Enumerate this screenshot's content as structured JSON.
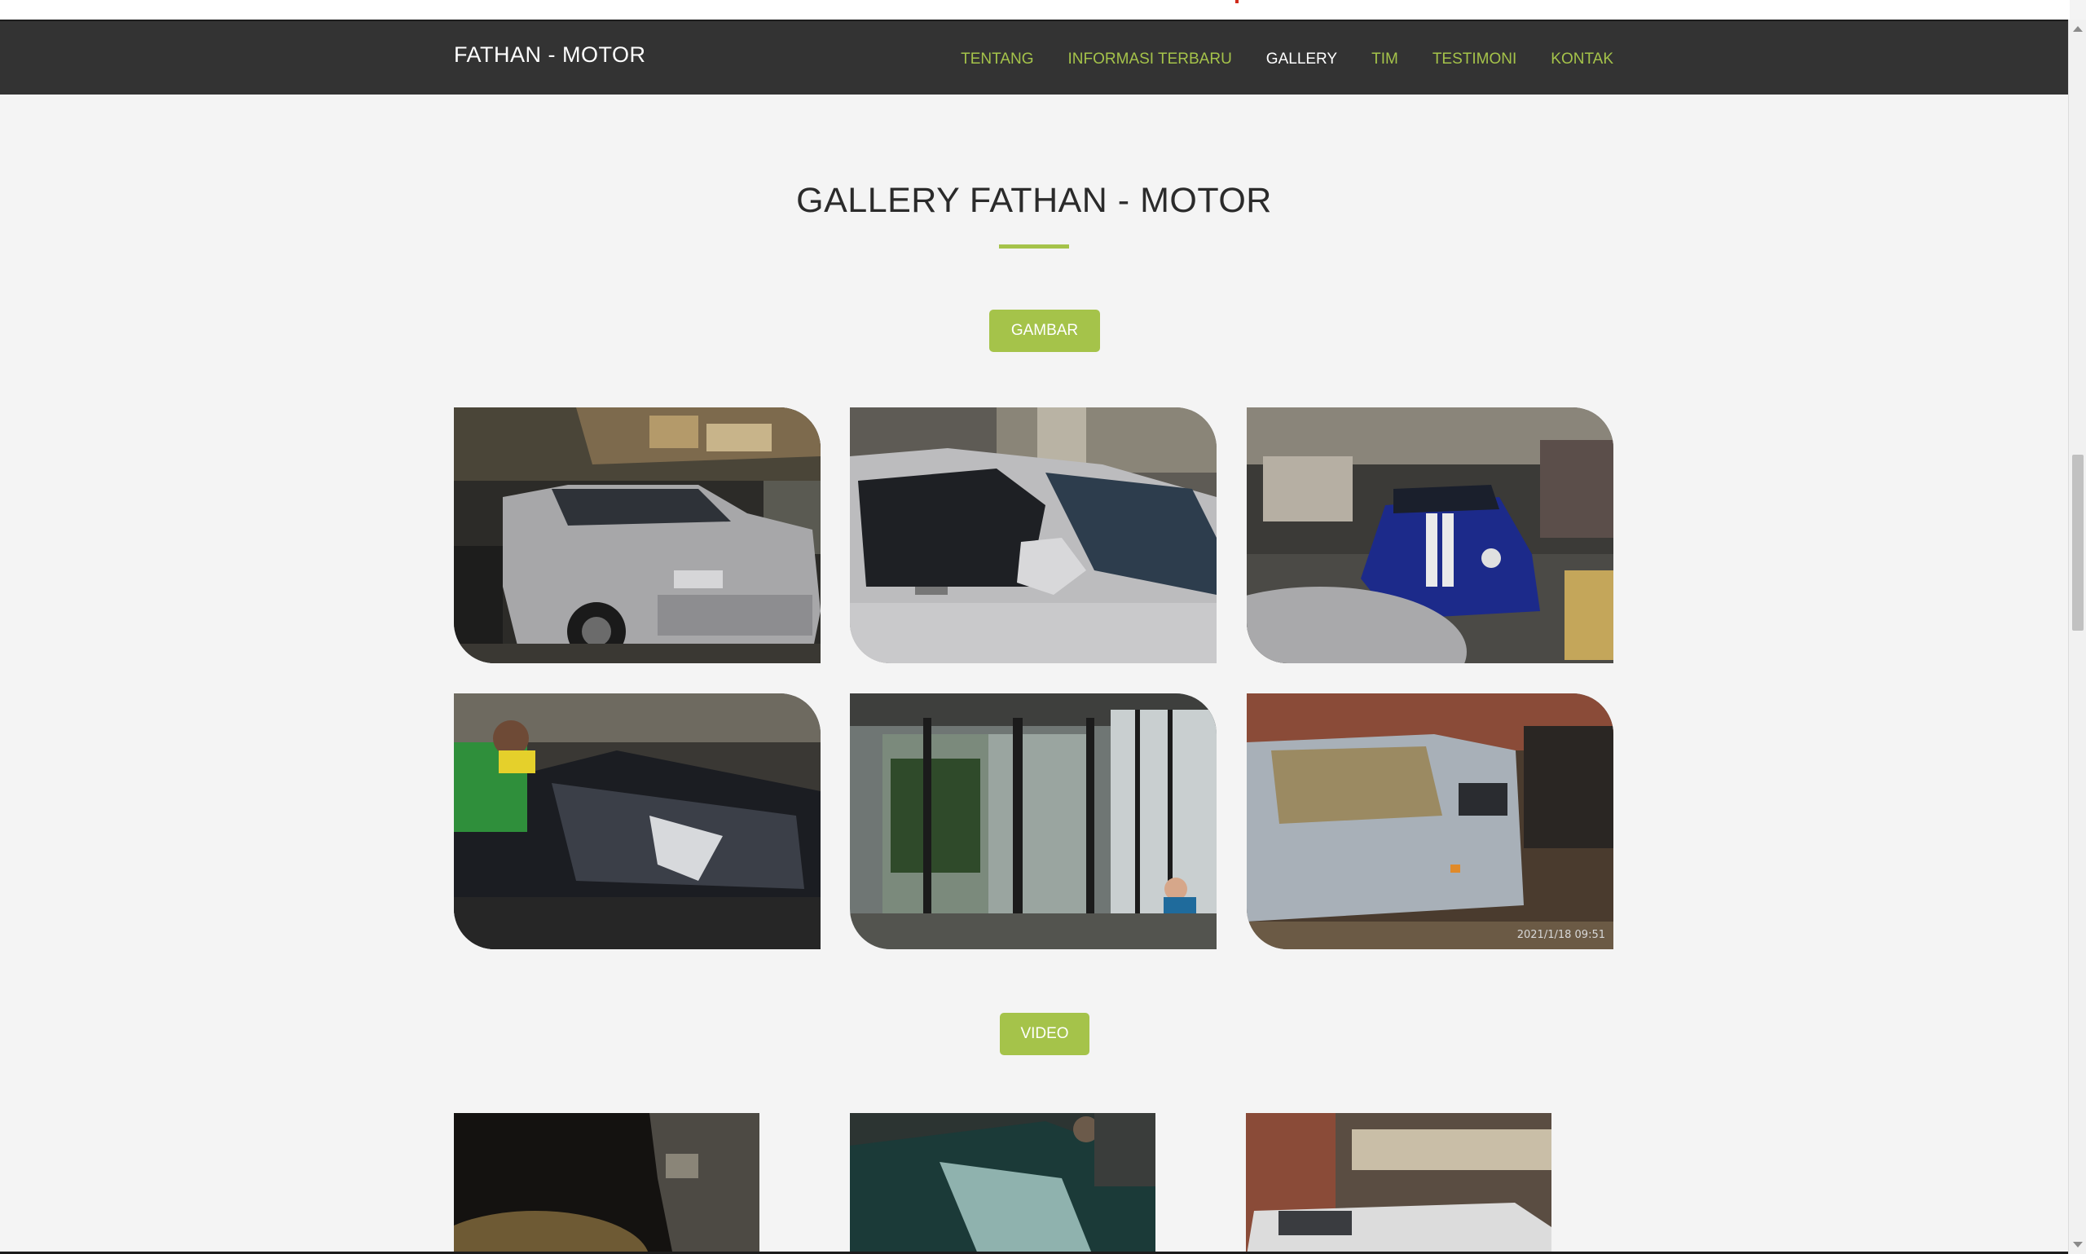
{
  "brand": "FATHAN - MOTOR",
  "nav": [
    {
      "label": "TENTANG",
      "active": false
    },
    {
      "label": "INFORMASI TERBARU",
      "active": false
    },
    {
      "label": "GALLERY",
      "active": true
    },
    {
      "label": "TIM",
      "active": false
    },
    {
      "label": "TESTIMONI",
      "active": false
    },
    {
      "label": "KONTAK",
      "active": false
    }
  ],
  "section": {
    "title": "GALLERY FATHAN - MOTOR",
    "gambar_label": "GAMBAR",
    "video_label": "VIDEO"
  },
  "photos": [
    {
      "subject": "silver-range-rover-in-garage"
    },
    {
      "subject": "silver-car-side-mirror"
    },
    {
      "subject": "blue-mini-cooper-in-garage"
    },
    {
      "subject": "worker-applying-film-on-black-car-hood"
    },
    {
      "subject": "glass-door-window-film-install"
    },
    {
      "subject": "grey-jimny-in-workshop",
      "timestamp": "2021/1/18 09:51"
    }
  ],
  "videos": [
    {
      "subject": "dark-garage-clip"
    },
    {
      "subject": "car-roof-clip"
    },
    {
      "subject": "white-car-in-workshop-clip"
    }
  ],
  "colors": {
    "navbar": "#333333",
    "accent": "#a5c34a",
    "background": "#f4f4f4"
  }
}
